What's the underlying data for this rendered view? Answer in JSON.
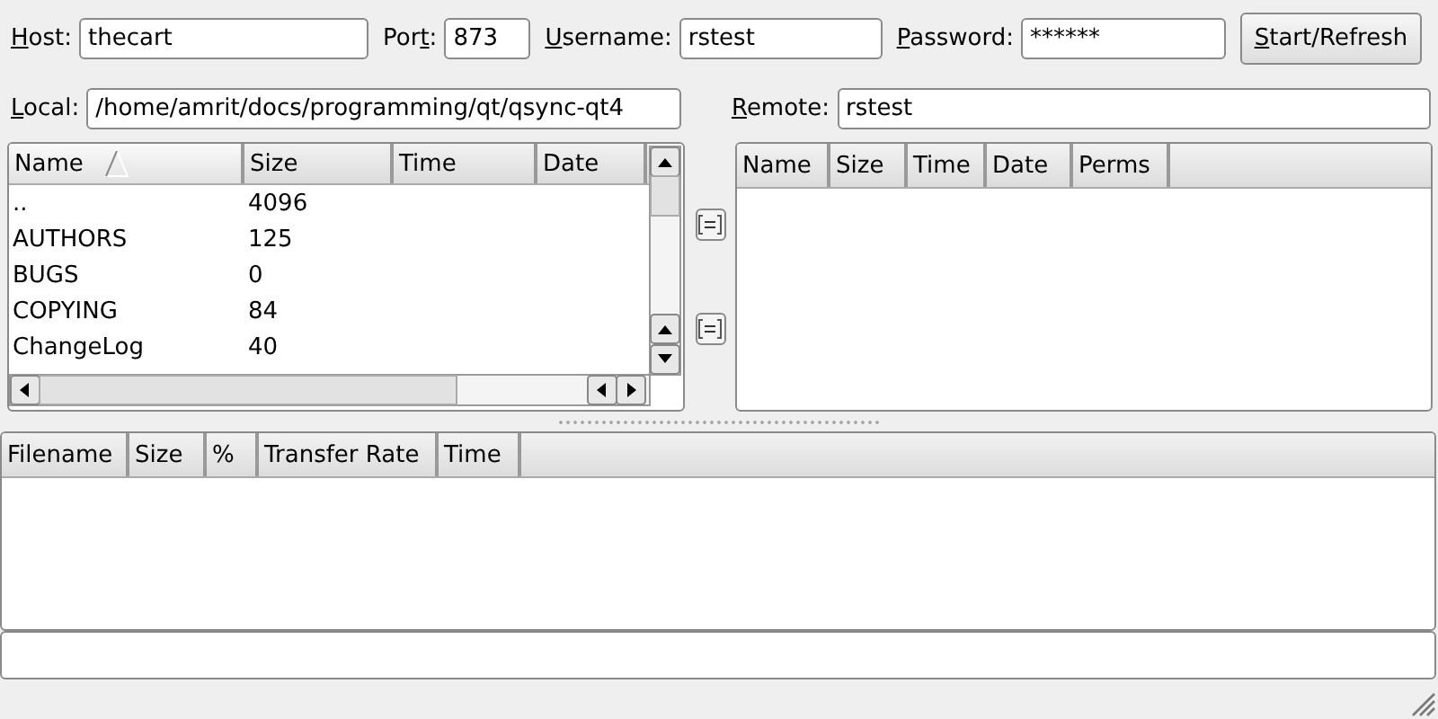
{
  "connection": {
    "fields": [
      {
        "label": {
          "key": "H",
          "after": "ost:"
        },
        "value": "thecart",
        "kind": "host"
      },
      {
        "label": {
          "before": "Por",
          "key": "t",
          "after": ":"
        },
        "value": "873",
        "kind": "port"
      },
      {
        "label": {
          "key": "U",
          "after": "sername:"
        },
        "value": "rstest",
        "kind": "user"
      },
      {
        "label": {
          "key": "P",
          "after": "assword:"
        },
        "value": "******",
        "kind": "password"
      }
    ],
    "button": {
      "key": "S",
      "after": "tart/Refresh"
    }
  },
  "local": {
    "label": {
      "key": "L",
      "after": "ocal:"
    },
    "path": "/home/amrit/docs/programming/qt/qsync-qt4",
    "columns": [
      {
        "label": "Name",
        "sorted": true
      },
      {
        "label": "Size",
        "sorted": false
      },
      {
        "label": "Time",
        "sorted": false
      },
      {
        "label": "Date",
        "sorted": false
      }
    ],
    "rows": [
      [
        "..",
        "4096"
      ],
      [
        "AUTHORS",
        "125"
      ],
      [
        "BUGS",
        "0"
      ],
      [
        "COPYING",
        "84"
      ],
      [
        "ChangeLog",
        "40"
      ]
    ]
  },
  "remote": {
    "label": {
      "key": "R",
      "after": "emote:"
    },
    "path": "rstest",
    "columns": [
      "Name",
      "Size",
      "Time",
      "Date",
      "Perms"
    ]
  },
  "transfers": {
    "columns": [
      "Filename",
      "Size",
      "%",
      "Transfer Rate",
      "Time"
    ]
  }
}
